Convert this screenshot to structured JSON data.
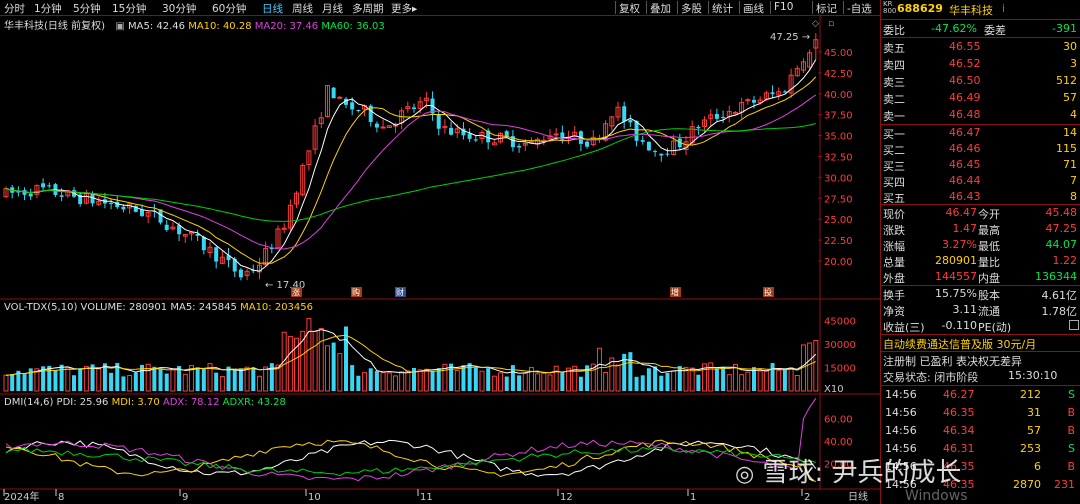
{
  "toolbar": {
    "tabs": [
      "分时",
      "1分钟",
      "5分钟",
      "15分钟",
      "30分钟",
      "60分钟",
      "日线",
      "周线",
      "月线",
      "多周期",
      "更多▸"
    ],
    "active": "日线",
    "right": [
      "复权",
      "叠加",
      "多股",
      "统计",
      "画线",
      "F10",
      "标记",
      "-自选",
      "返回"
    ]
  },
  "main_legend": {
    "title": "华丰科技(日线 前复权)",
    "ma5": "MA5: 42.46",
    "ma10": "MA10: 40.28",
    "ma20": "MA20: 37.46",
    "ma60": "MA60: 36.03"
  },
  "vol_legend": {
    "title": "VOL-TDX(5,10)",
    "volume": "VOLUME: 280901",
    "ma5": "MA5: 245845",
    "ma10": "MA10: 203456"
  },
  "dmi_legend": {
    "title": "DMI(14,6)",
    "pdi": "PDI: 25.96",
    "mdi": "MDI: 3.70",
    "adx": "ADX: 78.12",
    "adxr": "ADXR: 43.28"
  },
  "price_axis": [
    "45.00",
    "42.50",
    "40.00",
    "37.50",
    "35.00",
    "32.50",
    "30.00",
    "27.50",
    "25.00",
    "22.50",
    "20.00"
  ],
  "vol_axis": [
    "45000",
    "30000",
    "15000",
    "X10"
  ],
  "dmi_axis": [
    "60.00",
    "40.00",
    "20.00"
  ],
  "annotations": {
    "high": "47.25",
    "low": "17.40"
  },
  "event_markers": [
    "涨",
    "购",
    "财",
    "增",
    "投"
  ],
  "x_labels": [
    "2024年",
    "8",
    "9",
    "10",
    "11",
    "12",
    "1",
    "2"
  ],
  "x_corner": "日线",
  "colors": {
    "up": "#ff3b3b",
    "down": "#36d6f5",
    "ma5": "#ffffff",
    "ma10": "#ffd200",
    "ma20": "#e040e0",
    "ma60": "#00d000"
  },
  "quote": {
    "code_prefix": "KR\n800",
    "code": "688629",
    "name": "华丰科技",
    "ratio_label": "委比",
    "ratio": "-47.62%",
    "diff_label": "委差",
    "diff": "-391",
    "asks": [
      {
        "label": "卖五",
        "price": "46.55",
        "vol": "30"
      },
      {
        "label": "卖四",
        "price": "46.52",
        "vol": "3"
      },
      {
        "label": "卖三",
        "price": "46.50",
        "vol": "512"
      },
      {
        "label": "卖二",
        "price": "46.49",
        "vol": "57"
      },
      {
        "label": "卖一",
        "price": "46.48",
        "vol": "4"
      }
    ],
    "bids": [
      {
        "label": "买一",
        "price": "46.47",
        "vol": "14"
      },
      {
        "label": "买二",
        "price": "46.46",
        "vol": "115"
      },
      {
        "label": "买三",
        "price": "46.45",
        "vol": "71"
      },
      {
        "label": "买四",
        "price": "46.44",
        "vol": "7"
      },
      {
        "label": "买五",
        "price": "46.43",
        "vol": "8"
      }
    ],
    "stats": [
      {
        "l1": "现价",
        "v1": "46.47",
        "l2": "今开",
        "v2": "45.48",
        "c1": "red",
        "c2": "red"
      },
      {
        "l1": "涨跌",
        "v1": "1.47",
        "l2": "最高",
        "v2": "47.25",
        "c1": "red",
        "c2": "red"
      },
      {
        "l1": "涨幅",
        "v1": "3.27%",
        "l2": "最低",
        "v2": "44.07",
        "c1": "red",
        "c2": "grn"
      },
      {
        "l1": "总量",
        "v1": "280901",
        "l2": "量比",
        "v2": "1.22",
        "c1": "yel",
        "c2": "red"
      },
      {
        "l1": "外盘",
        "v1": "144557",
        "l2": "内盘",
        "v2": "136344",
        "c1": "red",
        "c2": "grn"
      }
    ],
    "fin": [
      {
        "l1": "换手",
        "v1": "15.75%",
        "l2": "股本",
        "v2": "4.61亿"
      },
      {
        "l1": "净资",
        "v1": "3.11",
        "l2": "流通",
        "v2": "1.78亿"
      },
      {
        "l1": "收益(三)",
        "v1": "-0.110",
        "l2": "PE(动)",
        "v2": ""
      }
    ],
    "promo": "自动续费通达信普及版 30元/月",
    "status1": "注册制 已盈利 表决权无差异",
    "status2_label": "交易状态: 闭市阶段",
    "status2_time": "15:30:10",
    "ticks": [
      {
        "t": "14:56",
        "p": "46.27",
        "v": "212",
        "s": "S"
      },
      {
        "t": "14:56",
        "p": "46.35",
        "v": "31",
        "s": "B"
      },
      {
        "t": "14:56",
        "p": "46.34",
        "v": "57",
        "s": "B"
      },
      {
        "t": "14:56",
        "p": "46.31",
        "v": "253",
        "s": "S"
      },
      {
        "t": "14:56",
        "p": "46.35",
        "v": "6",
        "s": "B"
      },
      {
        "t": "14:56",
        "p": "46.35",
        "v": "2870",
        "s": "231"
      }
    ]
  },
  "watermark": "雪球: 尹兵的成长",
  "watermark2": "Windows"
}
